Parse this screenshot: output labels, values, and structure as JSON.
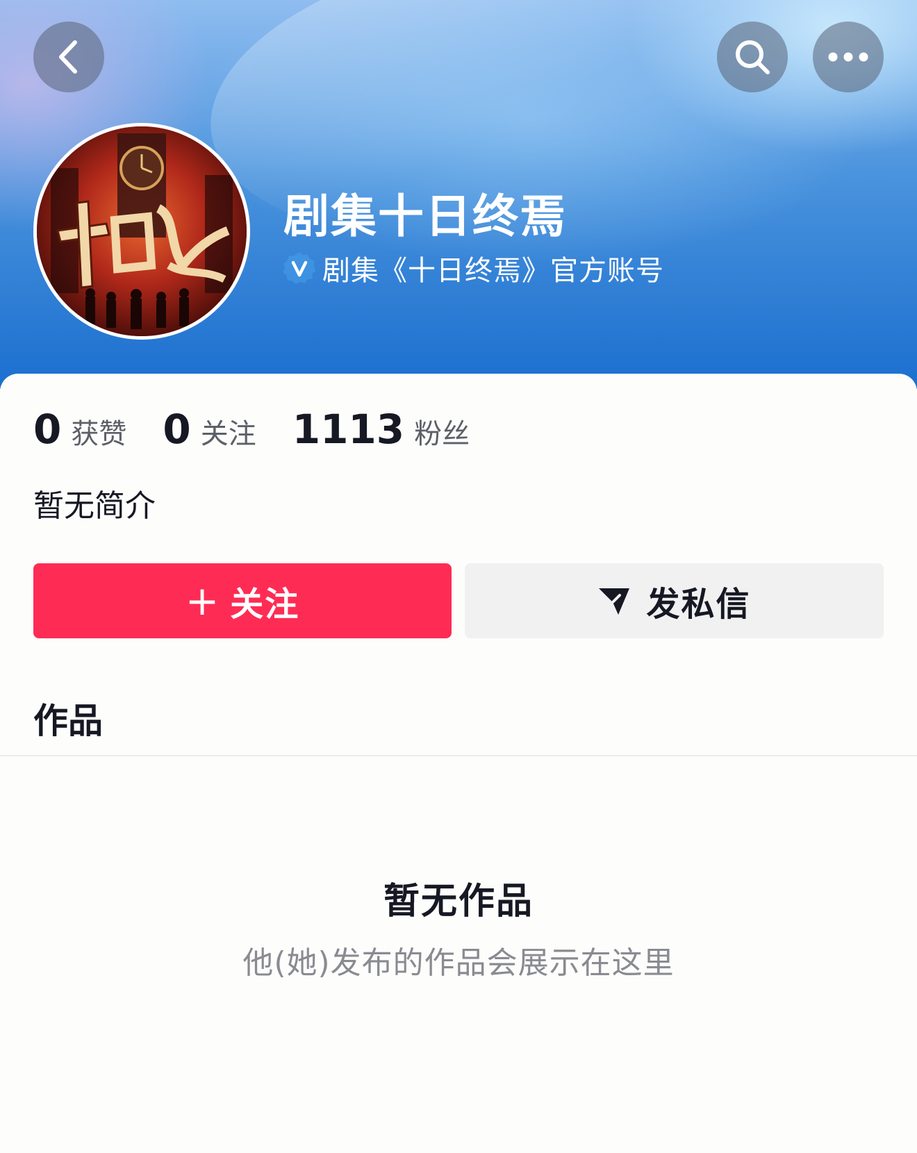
{
  "header": {
    "back_icon": "chevron-left-icon",
    "search_icon": "search-icon",
    "more_icon": "more-horizontal-icon"
  },
  "profile": {
    "name": "剧集十日终焉",
    "verified_icon": "verified-v-badge-icon",
    "verified_text": "剧集《十日终焉》官方账号",
    "avatar_title_text": "十日终焉"
  },
  "stats": [
    {
      "value": "0",
      "label": "获赞"
    },
    {
      "value": "0",
      "label": "关注"
    },
    {
      "value": "1113",
      "label": "粉丝"
    }
  ],
  "bio": "暂无简介",
  "actions": {
    "follow_plus": "+",
    "follow_label": "关注",
    "message_label": "发私信"
  },
  "tabs": {
    "works": "作品"
  },
  "empty_state": {
    "title": "暂无作品",
    "subtitle": "他(她)发布的作品会展示在这里"
  },
  "colors": {
    "follow_button": "#fe2c55",
    "message_button": "#f1f1f2",
    "header_blue": "#1b6fcf",
    "verified_badge": "#4fb0f5"
  }
}
